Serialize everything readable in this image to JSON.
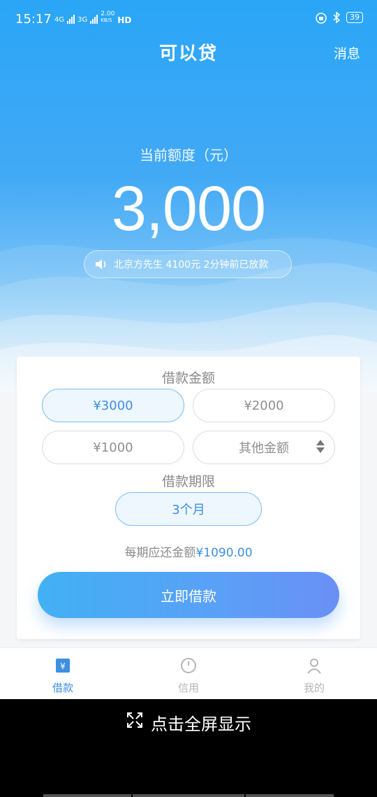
{
  "status_bar": {
    "time": "15:17",
    "net_speed_value": "2.00",
    "net_speed_unit": "KB/S",
    "net_1": "4G",
    "net_2": "3G",
    "hd": "HD",
    "battery": "39"
  },
  "header": {
    "title": "可以贷",
    "message_label": "消息"
  },
  "quota": {
    "label": "当前额度（元）",
    "value": "3,000"
  },
  "notice": {
    "text": "北京方先生 4100元 2分钟前已放款"
  },
  "loan_amount": {
    "title": "借款金额",
    "options": [
      {
        "label": "¥3000",
        "selected": true
      },
      {
        "label": "¥2000",
        "selected": false
      },
      {
        "label": "¥1000",
        "selected": false
      },
      {
        "label": "其他金额",
        "selected": false
      }
    ]
  },
  "loan_term": {
    "title": "借款期限",
    "selected": "3个月"
  },
  "repayment": {
    "label": "每期应还金额",
    "amount": "¥1090.00"
  },
  "borrow_button": "立即借款",
  "tabs": [
    {
      "label": "借款",
      "icon": "wallet-icon",
      "active": true
    },
    {
      "label": "信用",
      "icon": "gauge-icon",
      "active": false
    },
    {
      "label": "我的",
      "icon": "user-icon",
      "active": false
    }
  ],
  "overlay": {
    "fullscreen_label": "点击全屏显示",
    "icon": "expand-icon"
  },
  "colors": {
    "accent": "#3d8fe0",
    "hero_top": "#2aa6f7",
    "button_start": "#42b0f4",
    "button_end": "#6a8ff5"
  }
}
